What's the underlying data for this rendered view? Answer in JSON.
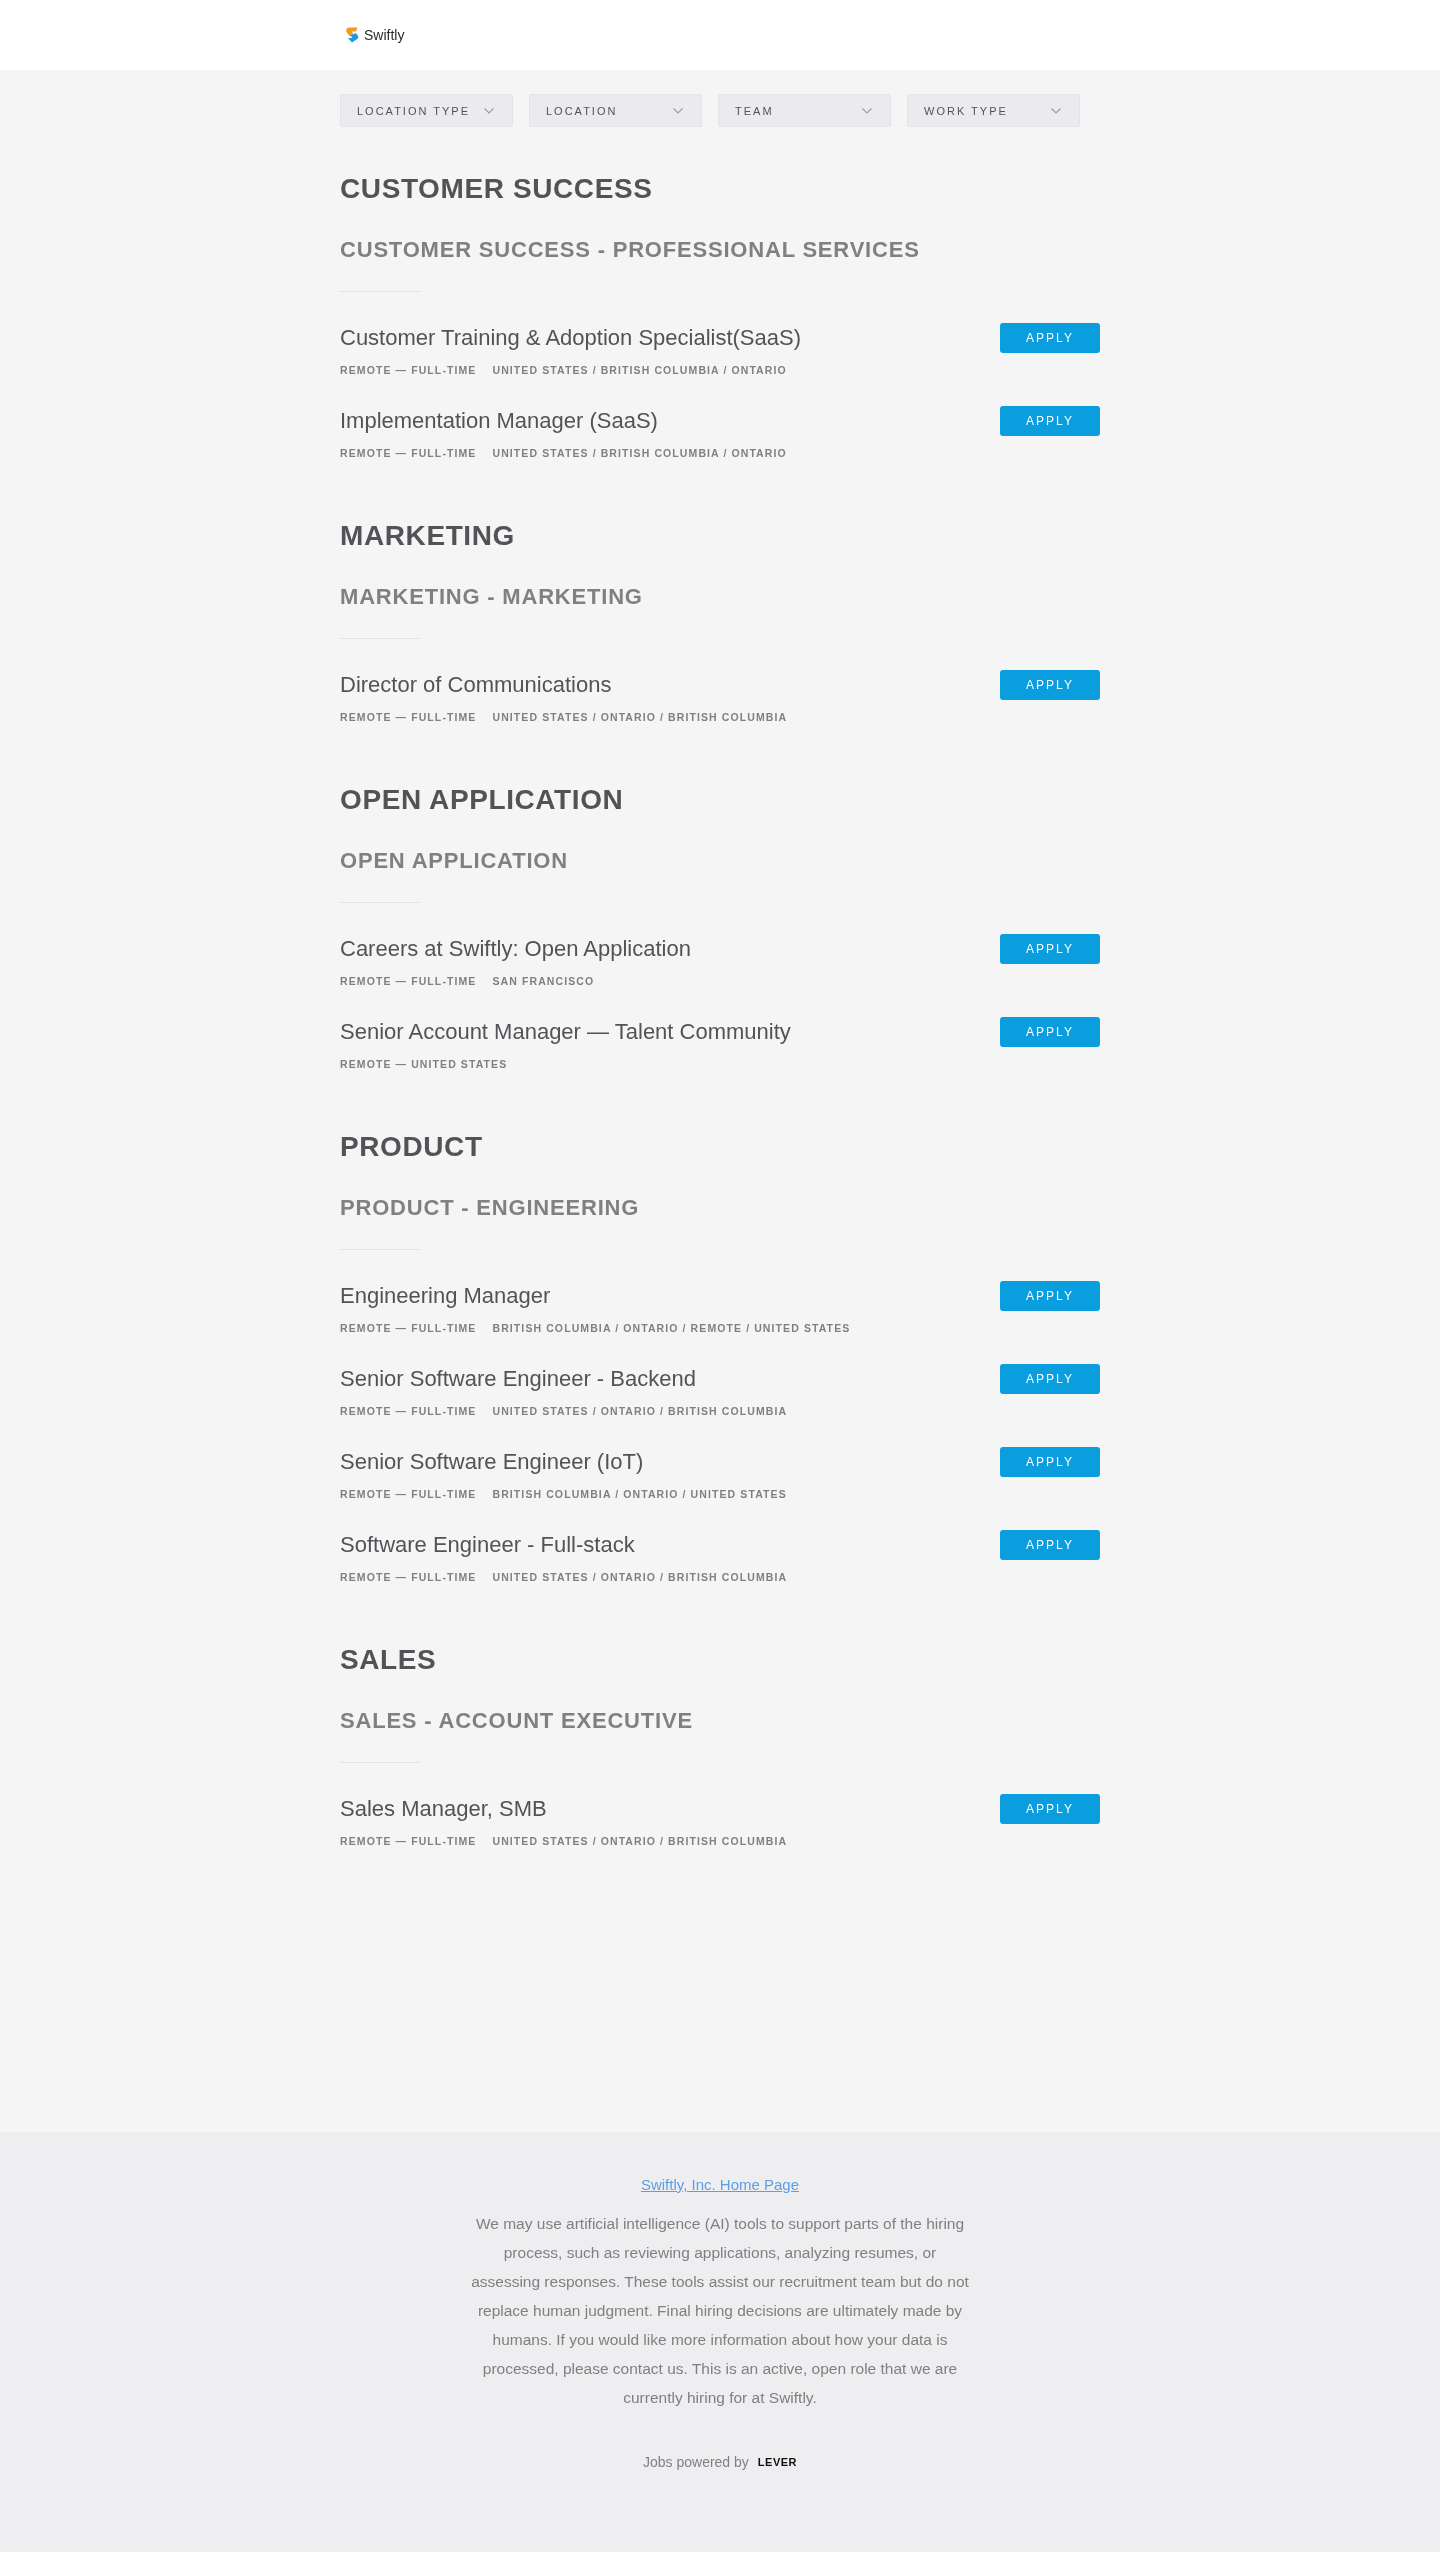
{
  "header": {
    "logo": "Swiftly"
  },
  "filters": [
    {
      "label": "LOCATION TYPE"
    },
    {
      "label": "LOCATION"
    },
    {
      "label": "TEAM"
    },
    {
      "label": "WORK TYPE"
    }
  ],
  "departments": [
    {
      "title": "CUSTOMER SUCCESS",
      "teams": [
        {
          "title": "CUSTOMER SUCCESS - PROFESSIONAL SERVICES",
          "postings": [
            {
              "title": "Customer Training & Adoption Specialist(SaaS)",
              "meta": [
                "REMOTE — FULL-TIME",
                "UNITED STATES / BRITISH COLUMBIA / ONTARIO"
              ],
              "action": "APPLY"
            },
            {
              "title": "Implementation Manager (SaaS)",
              "meta": [
                "REMOTE — FULL-TIME",
                "UNITED STATES / BRITISH COLUMBIA / ONTARIO"
              ],
              "action": "APPLY"
            }
          ]
        }
      ]
    },
    {
      "title": "MARKETING",
      "teams": [
        {
          "title": "MARKETING - MARKETING",
          "postings": [
            {
              "title": "Director of Communications",
              "meta": [
                "REMOTE — FULL-TIME",
                "UNITED STATES / ONTARIO / BRITISH COLUMBIA"
              ],
              "action": "APPLY"
            }
          ]
        }
      ]
    },
    {
      "title": "OPEN APPLICATION",
      "teams": [
        {
          "title": "OPEN APPLICATION",
          "postings": [
            {
              "title": "Careers at Swiftly: Open Application",
              "meta": [
                "REMOTE — FULL-TIME",
                "SAN FRANCISCO"
              ],
              "action": "APPLY"
            },
            {
              "title": "Senior Account Manager — Talent Community",
              "meta": [
                "REMOTE — UNITED STATES"
              ],
              "action": "APPLY"
            }
          ]
        }
      ]
    },
    {
      "title": "PRODUCT",
      "teams": [
        {
          "title": "PRODUCT - ENGINEERING",
          "postings": [
            {
              "title": "Engineering Manager",
              "meta": [
                "REMOTE — FULL-TIME",
                "BRITISH COLUMBIA / ONTARIO / REMOTE / UNITED STATES"
              ],
              "action": "APPLY"
            },
            {
              "title": "Senior Software Engineer - Backend",
              "meta": [
                "REMOTE — FULL-TIME",
                "UNITED STATES / ONTARIO / BRITISH COLUMBIA"
              ],
              "action": "APPLY"
            },
            {
              "title": "Senior Software Engineer (IoT)",
              "meta": [
                "REMOTE — FULL-TIME",
                "BRITISH COLUMBIA / ONTARIO / UNITED STATES"
              ],
              "action": "APPLY"
            },
            {
              "title": "Software Engineer - Full-stack",
              "meta": [
                "REMOTE — FULL-TIME",
                "UNITED STATES / ONTARIO / BRITISH COLUMBIA"
              ],
              "action": "APPLY"
            }
          ]
        }
      ]
    },
    {
      "title": "SALES",
      "teams": [
        {
          "title": "SALES - ACCOUNT EXECUTIVE",
          "postings": [
            {
              "title": "Sales Manager, SMB",
              "meta": [
                "REMOTE — FULL-TIME",
                "UNITED STATES / ONTARIO / BRITISH COLUMBIA"
              ],
              "action": "APPLY"
            }
          ]
        }
      ]
    }
  ],
  "footer": {
    "link": "Swiftly, Inc. Home Page",
    "disclaimer": "We may use artificial intelligence (AI) tools to support parts of the hiring process, such as reviewing applications, analyzing resumes, or assessing responses. These tools assist our recruitment team but do not replace human judgment. Final hiring decisions are ultimately made by humans. If you would like more information about how your data is processed, please contact us. This is an active, open role that we are currently hiring for at Swiftly.",
    "powered_by": "Jobs powered by",
    "powered_logo": "LEVER"
  }
}
